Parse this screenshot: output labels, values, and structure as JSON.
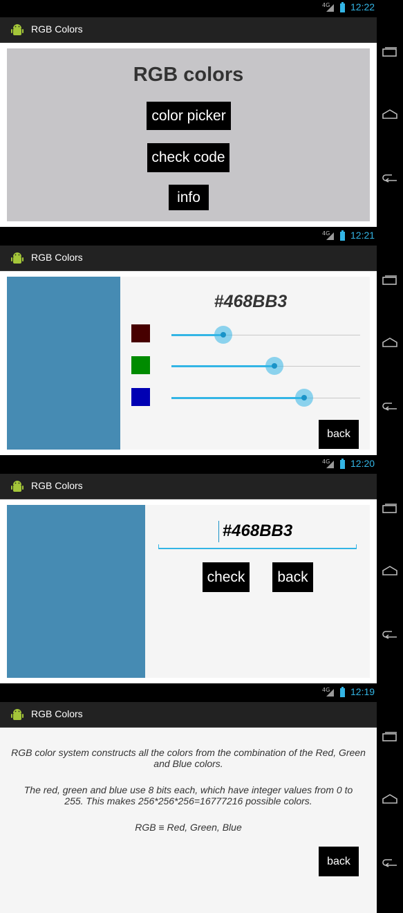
{
  "app": {
    "title": "RGB Colors"
  },
  "status_bar": {
    "network": "4G"
  },
  "screens": {
    "menu": {
      "time": "12:22",
      "heading": "RGB colors",
      "buttons": {
        "color_picker": "color picker",
        "check_code": "check code",
        "info": "info"
      }
    },
    "picker": {
      "time": "12:21",
      "hex": "#468BB3",
      "preview_color": "#468BB3",
      "channels": [
        {
          "name": "red",
          "swatch_color": "#470000",
          "value": 70,
          "max": 255
        },
        {
          "name": "green",
          "swatch_color": "#008B00",
          "value": 139,
          "max": 255
        },
        {
          "name": "blue",
          "swatch_color": "#0000B3",
          "value": 179,
          "max": 255
        }
      ],
      "back_label": "back"
    },
    "check": {
      "time": "12:20",
      "input_value": "#468BB3",
      "preview_color": "#468BB3",
      "check_label": "check",
      "back_label": "back"
    },
    "info": {
      "time": "12:19",
      "paragraph1": "RGB color system constructs all the colors from the combination of the Red, Green and Blue colors.",
      "paragraph2": "The red, green and blue use 8 bits each, which have integer values from 0 to 255. This makes 256*256*256=16777216 possible colors.",
      "paragraph3": "RGB  ≡  Red, Green, Blue",
      "back_label": "back"
    }
  },
  "colors": {
    "accent": "#33b5e5",
    "button_bg": "#000000",
    "panel_bg": "#f5f5f5",
    "menu_panel_bg": "#c6c5c8"
  },
  "icons": {
    "app": "android-icon",
    "recents": "recent-apps-icon",
    "home": "home-icon",
    "back": "back-arrow-icon"
  }
}
